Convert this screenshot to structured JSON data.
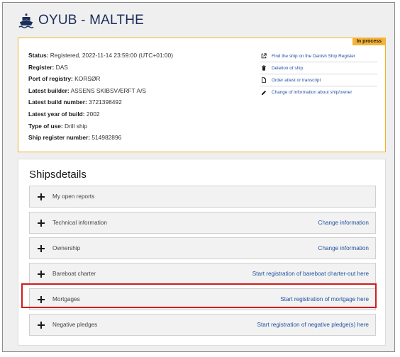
{
  "header": {
    "title": "OYUB - MALTHE",
    "icon": "ship-icon"
  },
  "status_panel": {
    "badge": "In process",
    "fields": [
      {
        "label": "Status:",
        "value": " Registered, 2022-11-14 23:59:00 (UTC+01:00)"
      },
      {
        "label": "Register:",
        "value": " DAS"
      },
      {
        "label": "Port of registry:",
        "value": " KORSØR"
      },
      {
        "label": "Latest builder:",
        "value": " ASSENS SKIBSVÆRFT A/S"
      },
      {
        "label": "Latest build number:",
        "value": " 3721398492"
      },
      {
        "label": "Latest year of build:",
        "value": " 2002"
      },
      {
        "label": "Type of use:",
        "value": " Drill ship"
      },
      {
        "label": "Ship register number:",
        "value": " 514982896"
      }
    ],
    "actions": [
      {
        "label": "Find the ship on the Danish Ship Register",
        "icon": "external-link-icon"
      },
      {
        "label": "Deletion of ship",
        "icon": "trash-icon"
      },
      {
        "label": "Order attest or transcript",
        "icon": "document-icon"
      },
      {
        "label": "Change of information about ship/owner",
        "icon": "pencil-icon"
      }
    ]
  },
  "details": {
    "title": "Shipsdetails",
    "sections": [
      {
        "label": "My open reports",
        "link": ""
      },
      {
        "label": "Technical information",
        "link": "Change information"
      },
      {
        "label": "Ownership",
        "link": "Change information"
      },
      {
        "label": "Bareboat charter",
        "link": "Start registration of bareboat charter-out here"
      },
      {
        "label": "Mortgages",
        "link": "Start registration of mortgage here"
      },
      {
        "label": "Negative pledges",
        "link": "Start registration of negative pledge(s) here"
      }
    ]
  },
  "colors": {
    "accent": "#1f4f9e",
    "status_border": "#f0b323",
    "badge": "#f5b335",
    "highlight": "#d7191c"
  }
}
